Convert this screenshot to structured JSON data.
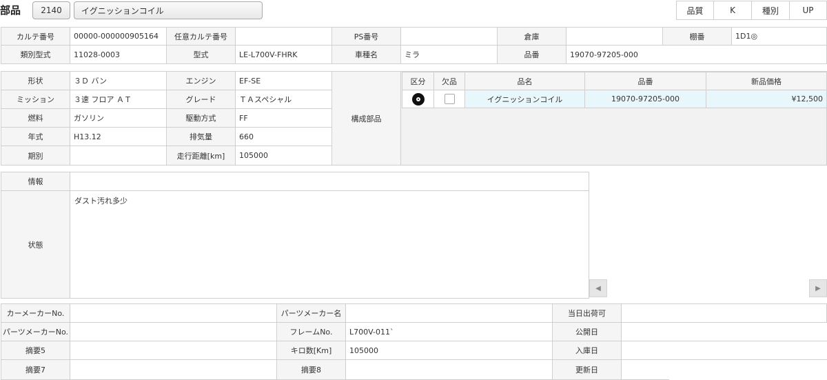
{
  "header": {
    "title": "部品",
    "part_code": "2140",
    "part_name": "イグニッションコイル",
    "quality_label": "品質",
    "quality_value": "K",
    "type_label": "種別",
    "type_value": "UP"
  },
  "row1": {
    "karte_label": "カルテ番号",
    "karte_value": "00000-000000905164",
    "opt_karte_label": "任意カルテ番号",
    "opt_karte_value": "",
    "ps_label": "PS番号",
    "ps_value": "",
    "warehouse_label": "倉庫",
    "warehouse_value": "",
    "shelf_label": "棚番",
    "shelf_value": "1D1◎"
  },
  "row2": {
    "cat_label": "類別型式",
    "cat_value": "11028-0003",
    "model_label": "型式",
    "model_value": "LE-L700V-FHRK",
    "car_label": "車種名",
    "car_value": "ミラ",
    "partno_label": "品番",
    "partno_value": "19070-97205-000"
  },
  "spec": {
    "shape_label": "形状",
    "shape_value": "３Ｄ バン",
    "engine_label": "エンジン",
    "engine_value": "EF-SE",
    "mission_label": "ミッション",
    "mission_value": "３速 フロア ＡＴ",
    "grade_label": "グレード",
    "grade_value": "ＴＡスペシャル",
    "fuel_label": "燃料",
    "fuel_value": "ガソリン",
    "drive_label": "駆動方式",
    "drive_value": "FF",
    "year_label": "年式",
    "year_value": "H13.12",
    "displacement_label": "排気量",
    "displacement_value": "660",
    "period_label": "期別",
    "period_value": "",
    "mileage_label": "走行距離[km]",
    "mileage_value": "105000",
    "components_label": "構成部品"
  },
  "parts_table": {
    "headers": [
      "区分",
      "欠品",
      "品名",
      "品番",
      "新品価格"
    ],
    "rows": [
      {
        "icon": "disc-icon",
        "missing": false,
        "name": "イグニッションコイル",
        "number": "19070-97205-000",
        "price": "¥12,500"
      }
    ]
  },
  "info": {
    "info_label": "情報",
    "info_value": "",
    "condition_label": "状態",
    "condition_value": "ダスト汚れ多少"
  },
  "bottom": {
    "car_maker_no_label": "カーメーカーNo.",
    "car_maker_no_value": "",
    "parts_maker_name_label": "パーツメーカー名",
    "parts_maker_name_value": "",
    "same_day_label": "当日出荷可",
    "same_day_value": "",
    "parts_maker_no_label": "パーツメーカーNo.",
    "parts_maker_no_value": "",
    "frame_label": "フレームNo.",
    "frame_value": "L700V-011`",
    "public_date_label": "公開日",
    "public_date_value": "",
    "summary5_label": "摘要5",
    "summary5_value": "",
    "km_label": "キロ数[Km]",
    "km_value": "105000",
    "stock_date_label": "入庫日",
    "stock_date_value": "",
    "summary7_label": "摘要7",
    "summary7_value": "",
    "summary8_label": "摘要8",
    "summary8_value": "",
    "update_date_label": "更新日",
    "update_date_value": ""
  }
}
